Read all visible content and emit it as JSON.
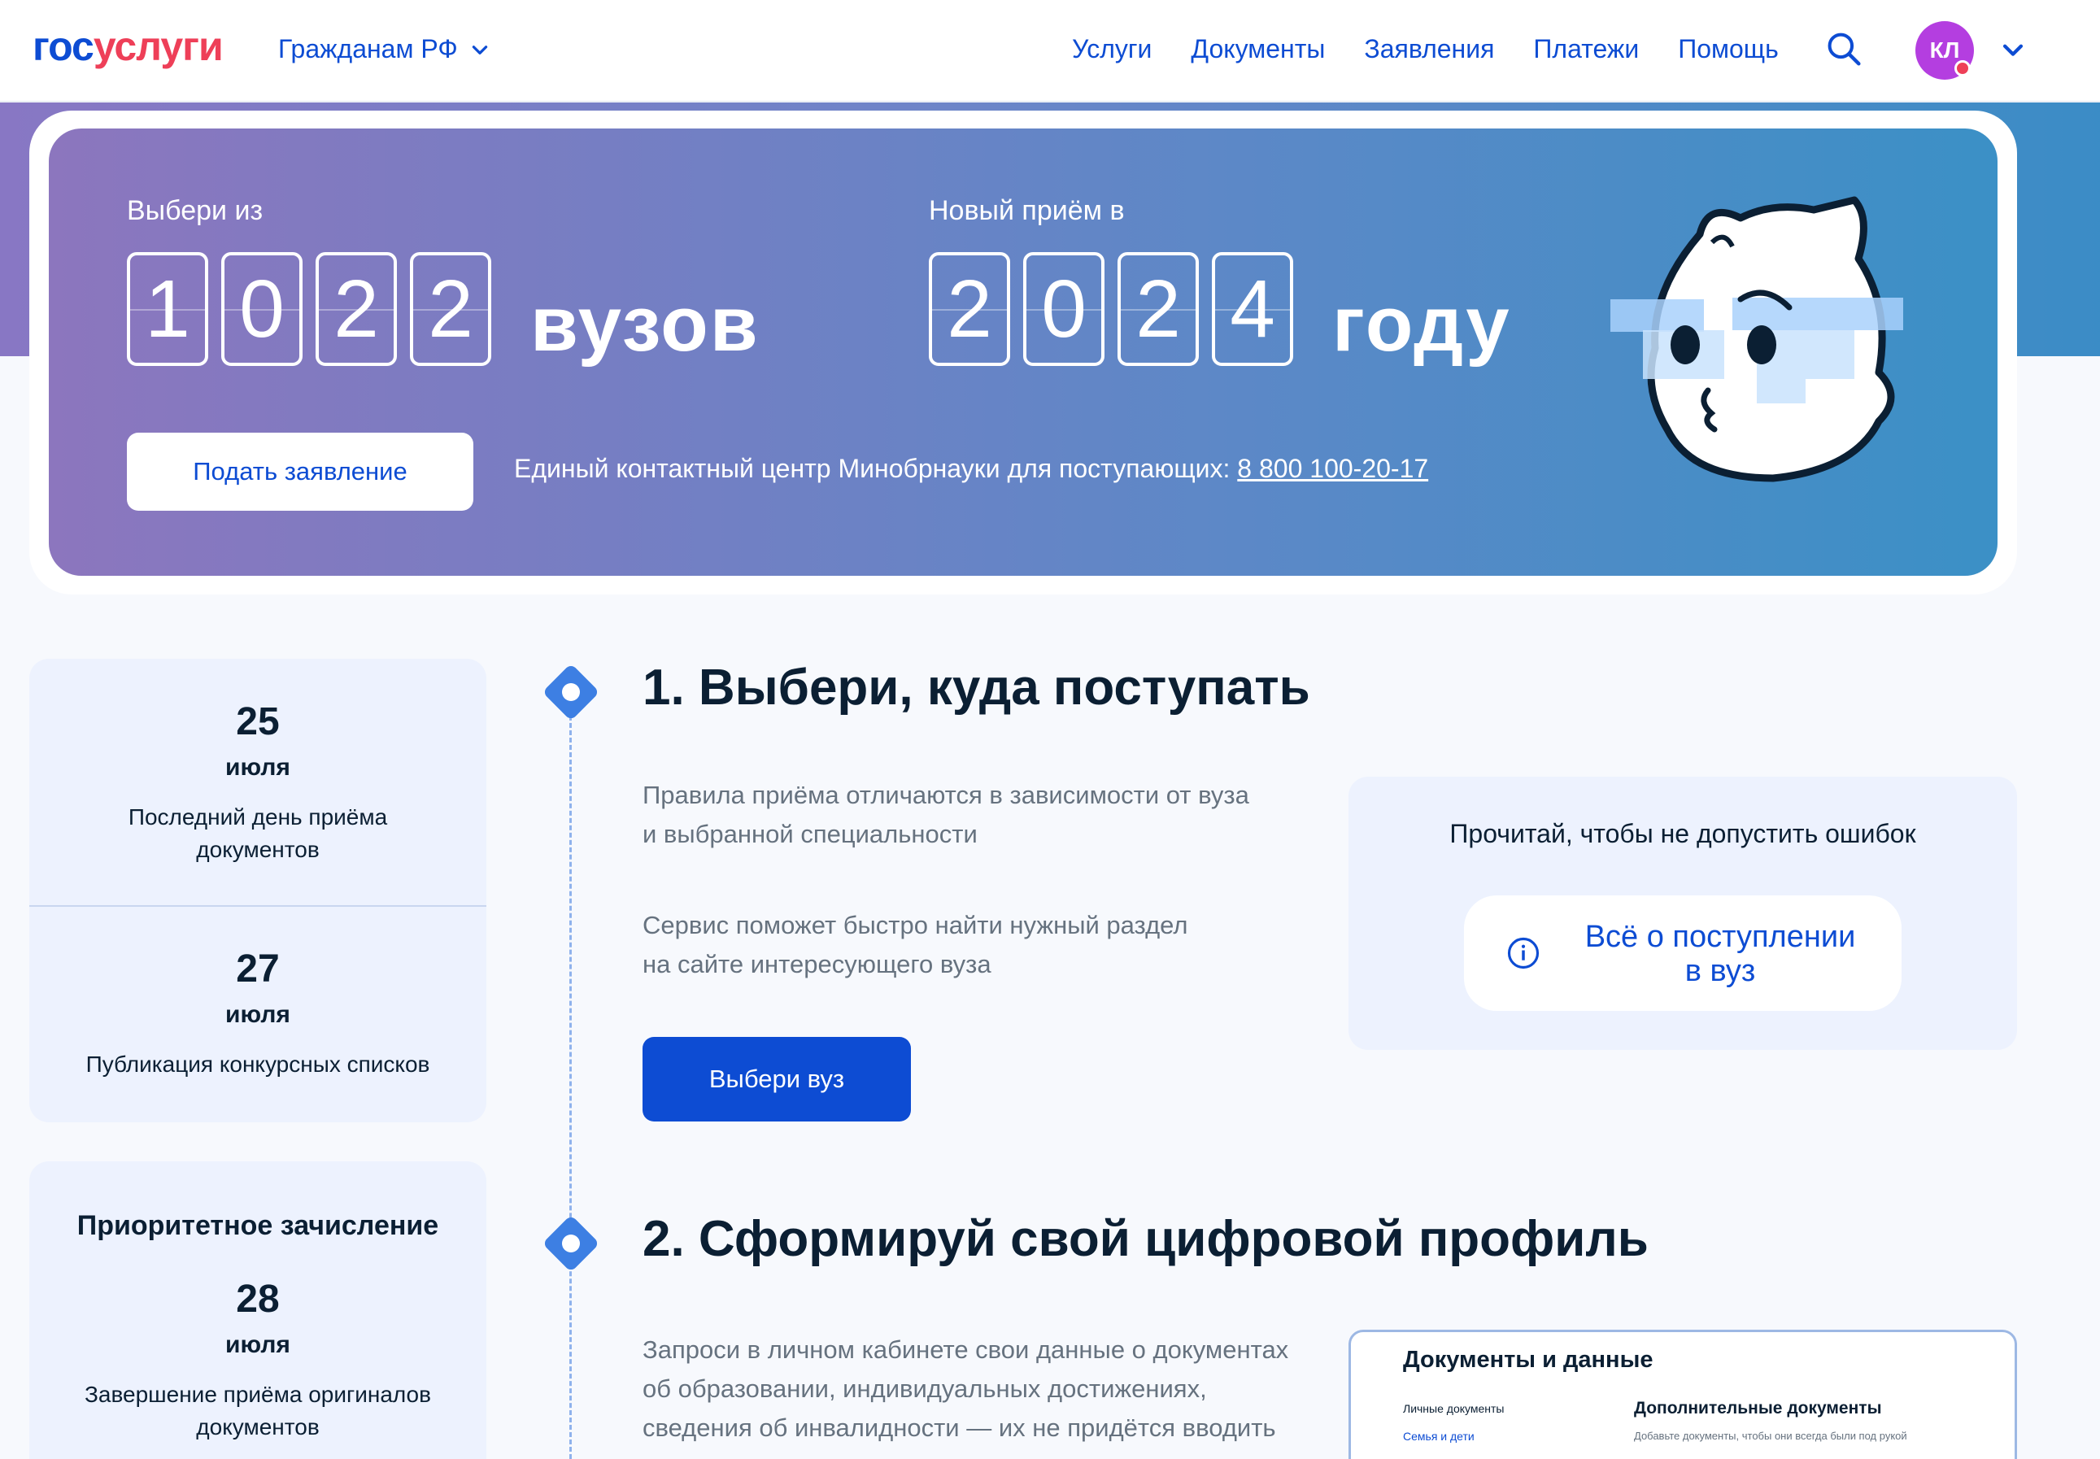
{
  "header": {
    "logo_part1": "гос",
    "logo_part2": "услуги",
    "region": "Гражданам РФ",
    "nav": [
      "Услуги",
      "Документы",
      "Заявления",
      "Платежи",
      "Помощь"
    ],
    "avatar_initials": "КЛ"
  },
  "hero": {
    "label_left": "Выбери из",
    "count_digits": [
      "1",
      "0",
      "2",
      "2"
    ],
    "count_word": "вузов",
    "label_right": "Новый приём в",
    "year_digits": [
      "2",
      "0",
      "2",
      "4"
    ],
    "year_word": "году",
    "apply_button": "Подать заявление",
    "contact_text": "Единый контактный центр Минобрнауки для поступающих:",
    "contact_phone": "8 800 100-20-17"
  },
  "dates": [
    {
      "day": "25",
      "month": "июля",
      "desc": "Последний день приёма документов"
    },
    {
      "day": "27",
      "month": "июля",
      "desc": "Публикация конкурсных списков"
    }
  ],
  "priority": {
    "title": "Приоритетное зачисление",
    "day": "28",
    "month": "июля",
    "desc": "Завершение приёма оригиналов документов"
  },
  "step1": {
    "title": "1. Выбери, куда поступать",
    "text1_line1": "Правила приёма отличаются в зависимости от вуза",
    "text1_line2": "и выбранной специальности",
    "text2_line1": "Сервис поможет быстро найти нужный раздел",
    "text2_line2": "на сайте интересующего вуза",
    "button": "Выбери вуз"
  },
  "info": {
    "title": "Прочитай, чтобы не допустить ошибок",
    "button_line1": "Всё о поступлении",
    "button_line2": "в вуз"
  },
  "step2": {
    "title": "2. Сформируй свой цифровой профиль",
    "text_line1": "Запроси в личном кабинете свои данные о документах",
    "text_line2": "об образовании, индивидуальных достижениях,",
    "text_line3": "сведения об инвалидности — их не придётся вводить"
  },
  "docs_preview": {
    "title": "Документы и данные",
    "side_a": "Личные документы",
    "side_b": "Семья и дети",
    "subtitle": "Дополнительные документы",
    "note": "Добавьте документы, чтобы они всегда были под рукой"
  },
  "colors": {
    "brand_blue": "#0d4cd3",
    "brand_red": "#ee3f58",
    "avatar": "#b43ee0",
    "marker": "#3d7fe3"
  }
}
